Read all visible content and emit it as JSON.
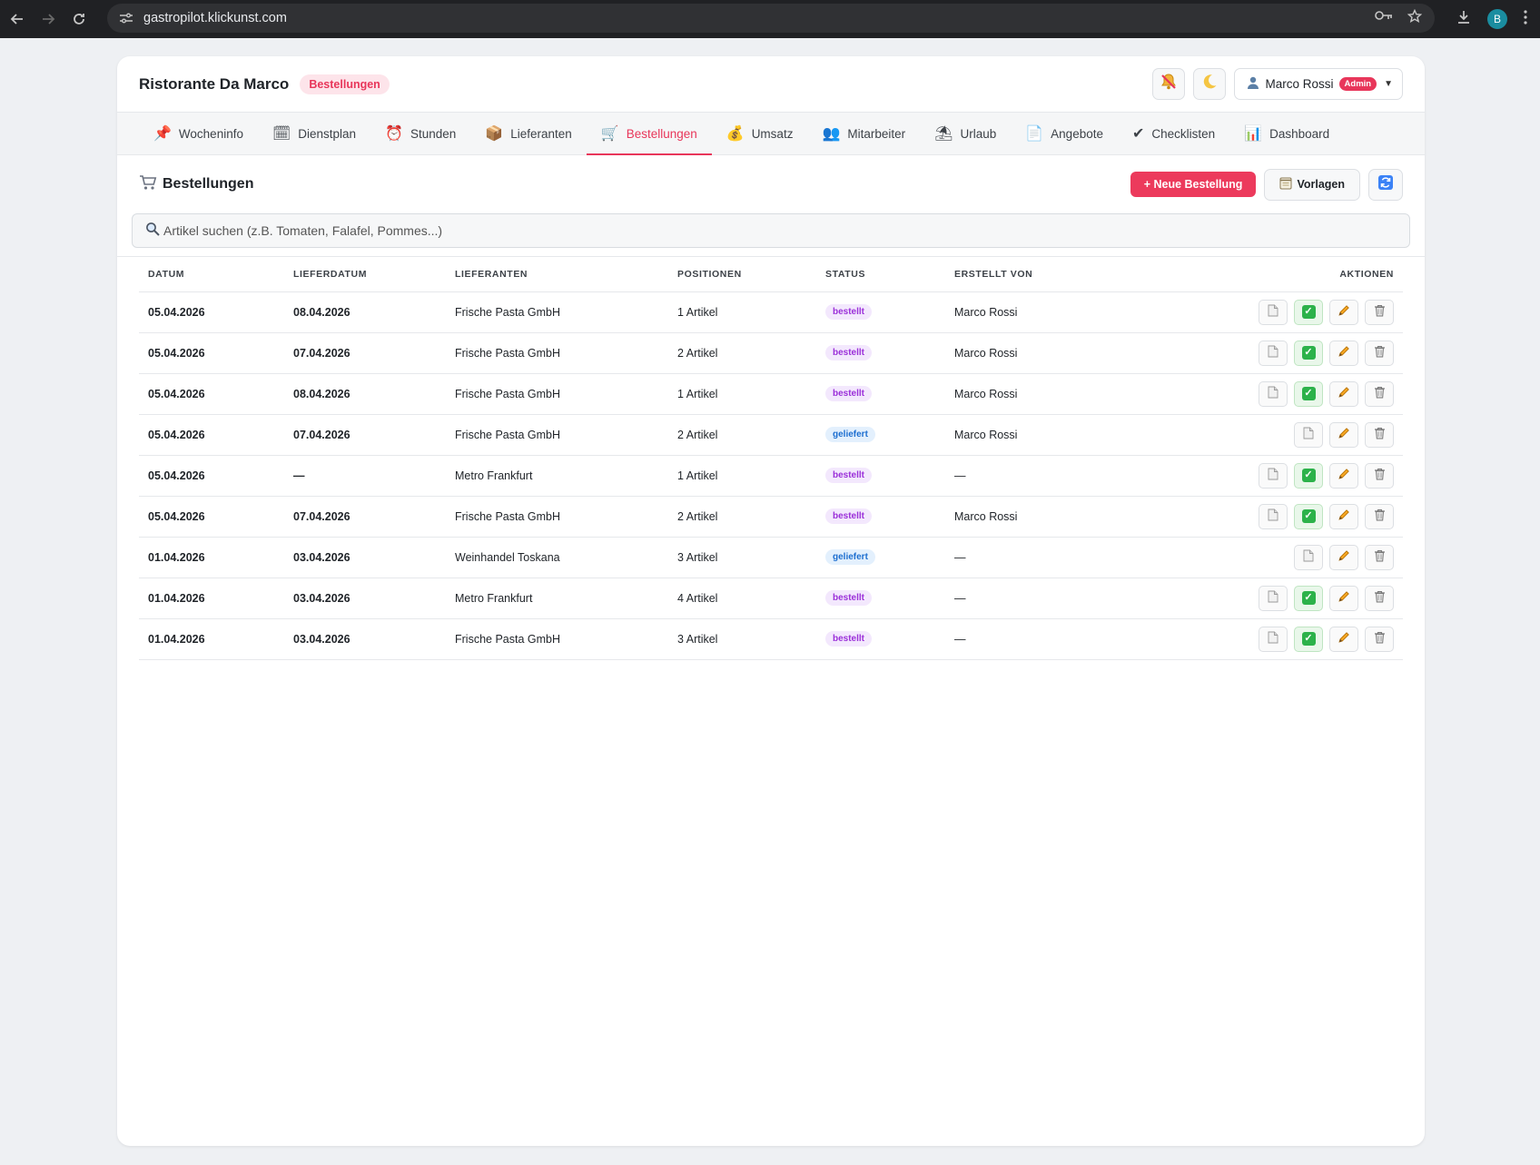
{
  "browser": {
    "url": "gastropilot.klickunst.com",
    "profile_initial": "B"
  },
  "header": {
    "restaurant_name": "Ristorante Da Marco",
    "page_badge": "Bestellungen",
    "user_name": "Marco Rossi",
    "user_role": "Admin"
  },
  "tabs": [
    {
      "label": "Wocheninfo",
      "icon": "pushpin-icon",
      "glyph": "📌"
    },
    {
      "label": "Dienstplan",
      "icon": "calendar-icon",
      "glyph": "🗓"
    },
    {
      "label": "Stunden",
      "icon": "alarm-clock-icon",
      "glyph": "⏰"
    },
    {
      "label": "Lieferanten",
      "icon": "package-icon",
      "glyph": "📦"
    },
    {
      "label": "Bestellungen",
      "icon": "shopping-cart-icon",
      "glyph": "🛒",
      "active": true
    },
    {
      "label": "Umsatz",
      "icon": "money-bag-icon",
      "glyph": "💰"
    },
    {
      "label": "Mitarbeiter",
      "icon": "people-icon",
      "glyph": "👥"
    },
    {
      "label": "Urlaub",
      "icon": "beach-umbrella-icon",
      "glyph": "⛱"
    },
    {
      "label": "Angebote",
      "icon": "document-icon",
      "glyph": "📄"
    },
    {
      "label": "Checklisten",
      "icon": "checkbox-icon",
      "glyph": "✔"
    },
    {
      "label": "Dashboard",
      "icon": "bar-chart-icon",
      "glyph": "📊"
    }
  ],
  "section": {
    "title": "Bestellungen",
    "new_order_label": "+ Neue Bestellung",
    "templates_label": "Vorlagen"
  },
  "search": {
    "placeholder": "Artikel suchen (z.B. Tomaten, Falafel, Pommes...)"
  },
  "table": {
    "columns": [
      "DATUM",
      "LIEFERDATUM",
      "LIEFERANTEN",
      "POSITIONEN",
      "STATUS",
      "ERSTELLT VON",
      "AKTIONEN"
    ],
    "rows": [
      {
        "datum": "05.04.2026",
        "lieferdatum": "08.04.2026",
        "lieferant": "Frische Pasta GmbH",
        "positionen": "1 Artikel",
        "status": "bestellt",
        "erstellt_von": "Marco Rossi"
      },
      {
        "datum": "05.04.2026",
        "lieferdatum": "07.04.2026",
        "lieferant": "Frische Pasta GmbH",
        "positionen": "2 Artikel",
        "status": "bestellt",
        "erstellt_von": "Marco Rossi"
      },
      {
        "datum": "05.04.2026",
        "lieferdatum": "08.04.2026",
        "lieferant": "Frische Pasta GmbH",
        "positionen": "1 Artikel",
        "status": "bestellt",
        "erstellt_von": "Marco Rossi"
      },
      {
        "datum": "05.04.2026",
        "lieferdatum": "07.04.2026",
        "lieferant": "Frische Pasta GmbH",
        "positionen": "2 Artikel",
        "status": "geliefert",
        "erstellt_von": "Marco Rossi"
      },
      {
        "datum": "05.04.2026",
        "lieferdatum": "—",
        "lieferant": "Metro Frankfurt",
        "positionen": "1 Artikel",
        "status": "bestellt",
        "erstellt_von": "—"
      },
      {
        "datum": "05.04.2026",
        "lieferdatum": "07.04.2026",
        "lieferant": "Frische Pasta GmbH",
        "positionen": "2 Artikel",
        "status": "bestellt",
        "erstellt_von": "Marco Rossi"
      },
      {
        "datum": "01.04.2026",
        "lieferdatum": "03.04.2026",
        "lieferant": "Weinhandel Toskana",
        "positionen": "3 Artikel",
        "status": "geliefert",
        "erstellt_von": "—"
      },
      {
        "datum": "01.04.2026",
        "lieferdatum": "03.04.2026",
        "lieferant": "Metro Frankfurt",
        "positionen": "4 Artikel",
        "status": "bestellt",
        "erstellt_von": "—"
      },
      {
        "datum": "01.04.2026",
        "lieferdatum": "03.04.2026",
        "lieferant": "Frische Pasta GmbH",
        "positionen": "3 Artikel",
        "status": "bestellt",
        "erstellt_von": "—"
      }
    ]
  },
  "colors": {
    "accent": "#ec3a5c",
    "status_bestellt": "#9b30d9",
    "status_geliefert": "#1e6fd0"
  }
}
